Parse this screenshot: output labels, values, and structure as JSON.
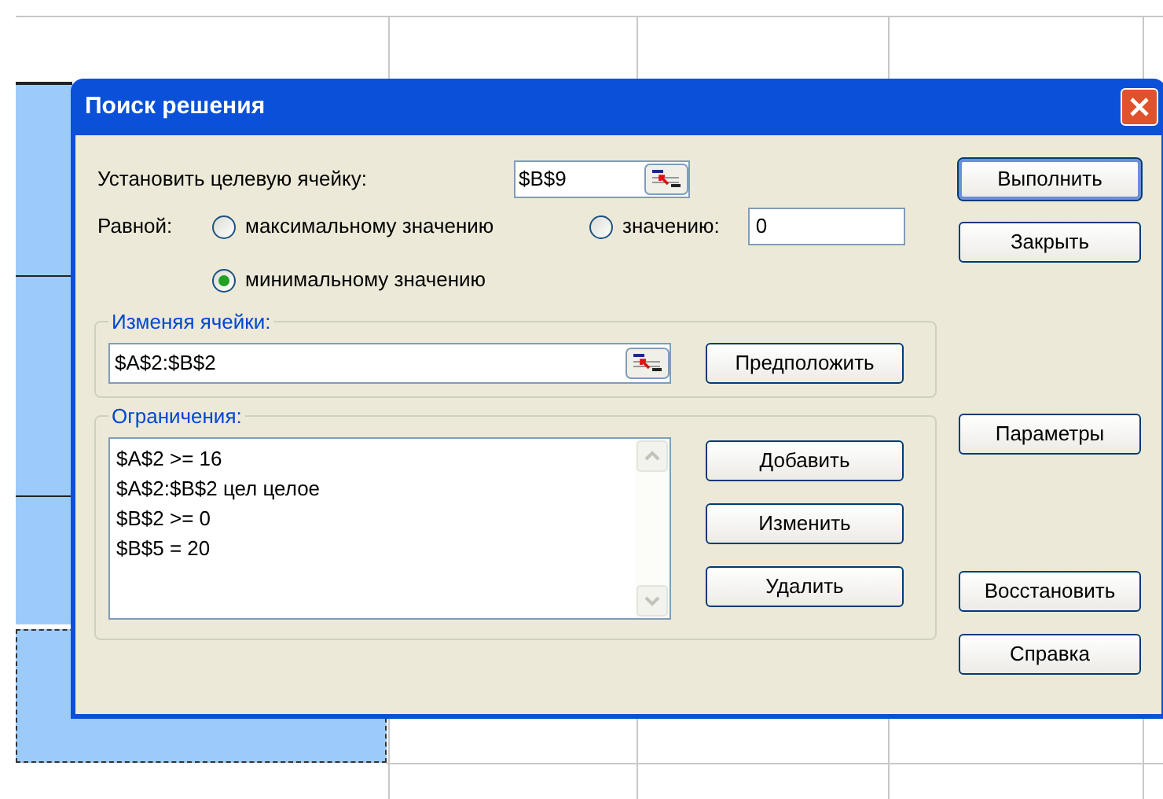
{
  "title": "Поиск решения",
  "target": {
    "label": "Установить целевую ячейку:",
    "value": "$B$9"
  },
  "equal": {
    "label": "Равной:",
    "options": [
      {
        "kind": "plain",
        "label": "максимальному значению",
        "selected": false
      },
      {
        "kind": "value",
        "label": "значению:",
        "selected": false,
        "value": "0"
      },
      {
        "kind": "plain",
        "label": "минимальному значению",
        "selected": true
      }
    ]
  },
  "changing": {
    "legend": "Изменяя ячейки:",
    "value": "$A$2:$B$2",
    "button": "Предположить"
  },
  "constraints": {
    "legend": "Ограничения:",
    "items": [
      "$A$2 >= 16",
      "$A$2:$B$2 цел целое",
      "$B$2 >= 0",
      "$B$5 = 20"
    ],
    "buttons": [
      "Добавить",
      "Изменить",
      "Удалить"
    ]
  },
  "side_button_groups": [
    [
      {
        "label": "Выполнить",
        "default": true
      },
      {
        "label": "Закрыть",
        "default": false
      }
    ],
    [
      {
        "label": "Параметры",
        "default": false
      }
    ],
    [
      {
        "label": "Восстановить",
        "default": false
      },
      {
        "label": "Справка",
        "default": false
      }
    ]
  ]
}
